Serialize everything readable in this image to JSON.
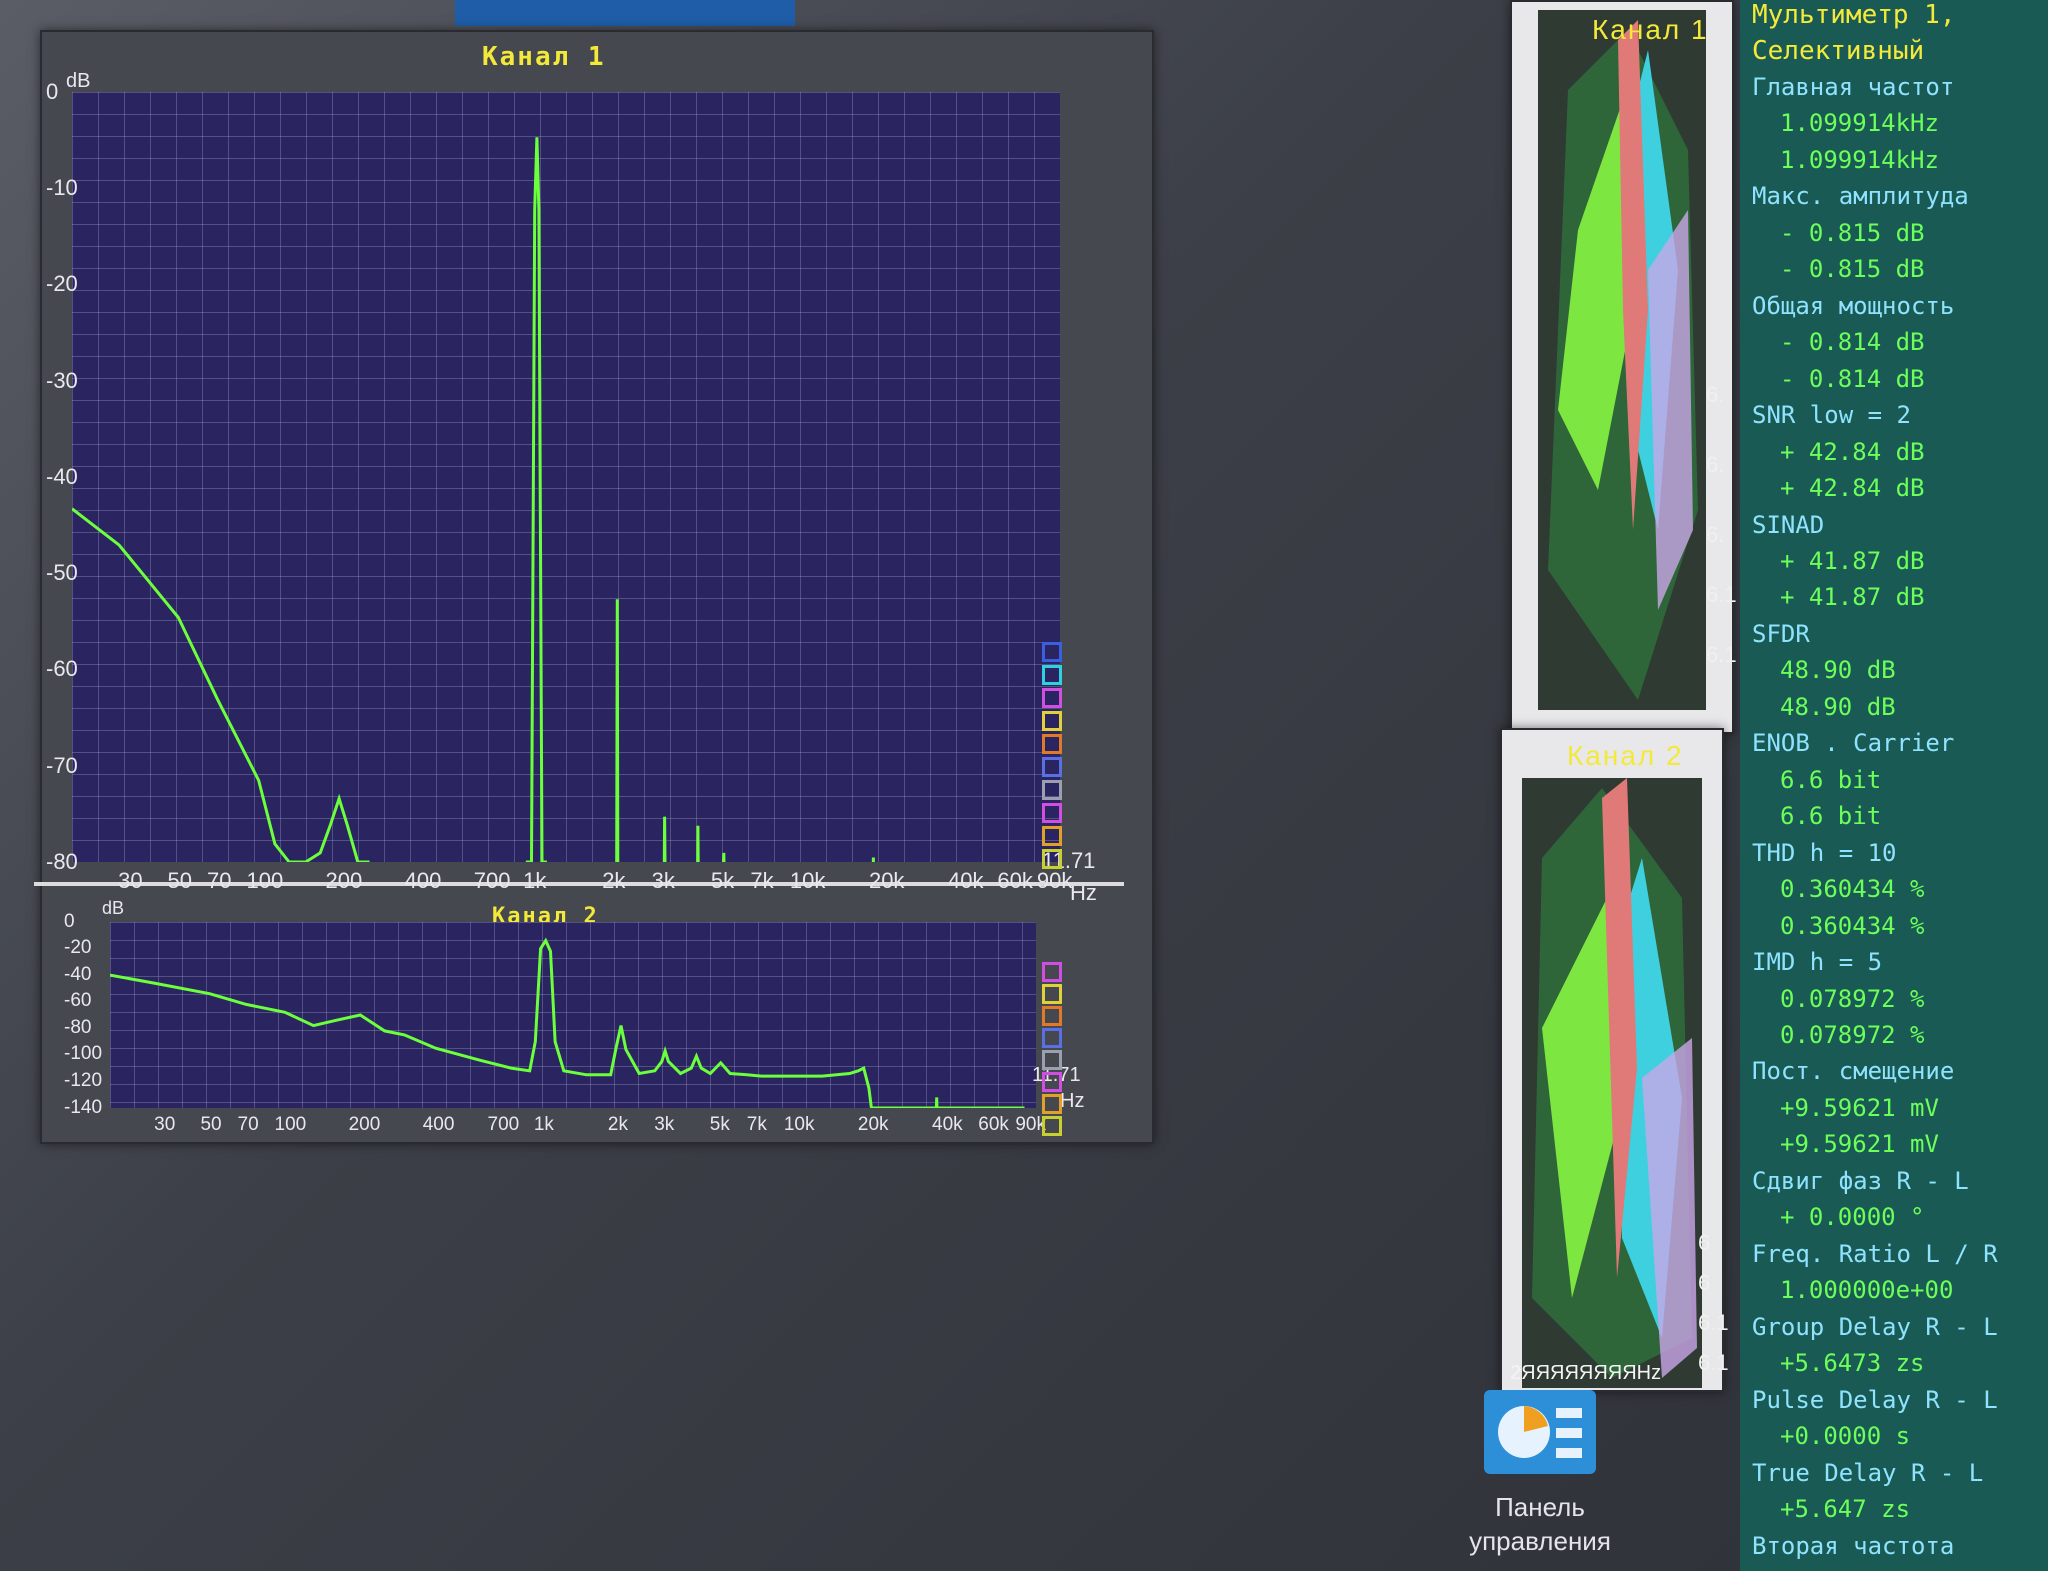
{
  "ch1": {
    "title": "Канал 1",
    "y_unit": "dB",
    "y_ticks": [
      "0",
      "-10",
      "-20",
      "-30",
      "-40",
      "-50",
      "-60",
      "-70",
      "-80"
    ],
    "x_ticks": [
      "30",
      "50",
      "70",
      "100",
      "200",
      "400",
      "700",
      "1k",
      "2k",
      "3k",
      "5k",
      "7k",
      "10k",
      "20k",
      "40k",
      "60k",
      "90k"
    ],
    "x_unit": "Hz",
    "corner_value": "11.71"
  },
  "ch2": {
    "title": "Канал 2",
    "y_unit": "dB",
    "y_ticks": [
      "0",
      "-20",
      "-40",
      "-60",
      "-80",
      "-100",
      "-120",
      "-140"
    ],
    "x_ticks": [
      "30",
      "50",
      "70",
      "100",
      "200",
      "400",
      "700",
      "1k",
      "2k",
      "3k",
      "5k",
      "7k",
      "10k",
      "20k",
      "40k",
      "60k",
      "90k"
    ],
    "x_unit": "Hz",
    "corner_value": "11.71"
  },
  "chart_data": [
    {
      "type": "line",
      "title": "Канал 1",
      "ylabel": "dB",
      "xlabel": "Hz",
      "x_scale": "log",
      "xlim": [
        20,
        100000
      ],
      "ylim": [
        -80,
        5
      ],
      "grid": true,
      "series": [
        {
          "x": [
            20,
            30,
            50,
            70,
            100,
            115,
            130,
            150,
            170,
            185,
            200,
            215,
            235,
            260
          ],
          "y": [
            -41,
            -45,
            -53,
            -62,
            -71,
            -78,
            -80,
            -80,
            -79,
            -76,
            -73,
            -76,
            -80,
            -80
          ]
        },
        {
          "x": [
            1000,
            1050,
            1080,
            1100,
            1120,
            1150,
            1200
          ],
          "y": [
            -80,
            -80,
            -8,
            0,
            -8,
            -80,
            -80
          ]
        },
        {
          "x": [
            2170,
            2190,
            2200,
            2210,
            2230
          ],
          "y": [
            -80,
            -80,
            -51,
            -80,
            -80
          ]
        },
        {
          "x": [
            3300,
            3310,
            3320
          ],
          "y": [
            -80,
            -75,
            -80
          ]
        },
        {
          "x": [
            4400,
            4410,
            4420
          ],
          "y": [
            -80,
            -76,
            -80
          ]
        },
        {
          "x": [
            5500,
            5510,
            5520
          ],
          "y": [
            -80,
            -79,
            -80
          ]
        },
        {
          "x": [
            20000,
            20010,
            20020
          ],
          "y": [
            -80,
            -79.5,
            -80
          ]
        }
      ]
    },
    {
      "type": "line",
      "title": "Канал 2",
      "ylabel": "dB",
      "xlabel": "Hz",
      "x_scale": "log",
      "xlim": [
        20,
        100000
      ],
      "ylim": [
        -140,
        0
      ],
      "grid": true,
      "series": [
        {
          "x": [
            20,
            30,
            50,
            70,
            100,
            130,
            160,
            200,
            250,
            300,
            400,
            600,
            800,
            950,
            1000,
            1050,
            1100,
            1150,
            1200,
            1300,
            1600,
            2000,
            2100,
            2200,
            2300,
            2600,
            3000,
            3200,
            3300,
            3400,
            3800,
            4200,
            4400,
            4600,
            5000,
            5500,
            6000,
            7000,
            8000,
            10000,
            14000,
            18000,
            19500,
            20500,
            21500,
            22000,
            40000,
            60000,
            90000
          ],
          "y": [
            -40,
            -46,
            -54,
            -62,
            -68,
            -78,
            -74,
            -70,
            -82,
            -85,
            -95,
            -104,
            -110,
            -112,
            -90,
            -20,
            -14,
            -22,
            -90,
            -112,
            -115,
            -115,
            -95,
            -78,
            -96,
            -114,
            -112,
            -105,
            -97,
            -105,
            -114,
            -110,
            -101,
            -110,
            -114,
            -106,
            -114,
            -115,
            -116,
            -116,
            -116,
            -114,
            -112,
            -110,
            -125,
            -140,
            -140,
            -140,
            -140
          ]
        },
        {
          "x": [
            40000,
            40100,
            40200
          ],
          "y": [
            -140,
            -132,
            -140
          ]
        }
      ]
    }
  ],
  "waterfall1": {
    "title": "Канал 1",
    "side_ticks": [
      "6.",
      "6.",
      "6.",
      "6.1",
      "6.1"
    ]
  },
  "waterfall2": {
    "title": "Канал 2",
    "bottom_label": "2ЯЯЯЯЯЯЯЯHz",
    "side_ticks": [
      "6",
      "6",
      "6.1",
      "6.1"
    ]
  },
  "control_panel": {
    "label_line1": "Панель",
    "label_line2": "управления"
  },
  "multimeter": {
    "rows": [
      {
        "text": "Мультиметр 1,",
        "kind": "title"
      },
      {
        "text": "Селективный",
        "kind": "title"
      },
      {
        "text": "Главная частот",
        "kind": "label"
      },
      {
        "text": "1.099914kHz",
        "kind": "value"
      },
      {
        "text": "1.099914kHz",
        "kind": "value"
      },
      {
        "text": "Макс. амплитуда",
        "kind": "label"
      },
      {
        "text": "-  0.815 dB",
        "kind": "value"
      },
      {
        "text": "-  0.815 dB",
        "kind": "value"
      },
      {
        "text": "Общая мощность",
        "kind": "label"
      },
      {
        "text": "-  0.814 dB",
        "kind": "value"
      },
      {
        "text": "-  0.814 dB",
        "kind": "value"
      },
      {
        "text": "SNR    low =  2",
        "kind": "label"
      },
      {
        "text": "+ 42.84 dB",
        "kind": "value"
      },
      {
        "text": "+ 42.84 dB",
        "kind": "value"
      },
      {
        "text": "SINAD",
        "kind": "label"
      },
      {
        "text": "+ 41.87 dB",
        "kind": "value"
      },
      {
        "text": "+ 41.87 dB",
        "kind": "value"
      },
      {
        "text": "SFDR",
        "kind": "label"
      },
      {
        "text": "48.90 dB",
        "kind": "value"
      },
      {
        "text": "48.90 dB",
        "kind": "value"
      },
      {
        "text": "ENOB . Carrier",
        "kind": "label"
      },
      {
        "text": "6.6 bit",
        "kind": "value"
      },
      {
        "text": "6.6 bit",
        "kind": "value"
      },
      {
        "text": "THD      h = 10",
        "kind": "label"
      },
      {
        "text": "0.360434 %",
        "kind": "value"
      },
      {
        "text": "0.360434 %",
        "kind": "value"
      },
      {
        "text": "IMD      h =  5",
        "kind": "label"
      },
      {
        "text": "0.078972 %",
        "kind": "value"
      },
      {
        "text": "0.078972 %",
        "kind": "value"
      },
      {
        "text": "Пост. смещение",
        "kind": "label"
      },
      {
        "text": "+9.59621 mV",
        "kind": "value"
      },
      {
        "text": "+9.59621 mV",
        "kind": "value"
      },
      {
        "text": "Сдвиг фаз R - L",
        "kind": "label"
      },
      {
        "text": "+  0.0000 °",
        "kind": "value"
      },
      {
        "text": "Freq. Ratio  L / R",
        "kind": "label"
      },
      {
        "text": "1.000000e+00",
        "kind": "value"
      },
      {
        "text": "Group Delay R - L",
        "kind": "label"
      },
      {
        "text": "+5.6473 zs",
        "kind": "value"
      },
      {
        "text": "Pulse Delay R - L",
        "kind": "label"
      },
      {
        "text": "+0.0000  s",
        "kind": "value"
      },
      {
        "text": "True Delay R - L",
        "kind": "label"
      },
      {
        "text": "+5.647 zs",
        "kind": "value"
      },
      {
        "text": "Вторая частота",
        "kind": "label"
      }
    ]
  },
  "colors": {
    "plot_bg": "#2a2560",
    "trace": "#6cff3c",
    "title": "#f2e93a",
    "meter_label": "#8fe3ff",
    "meter_value": "#6cff5a"
  },
  "legend1": [
    "#3a5fe0",
    "#2fd0e0",
    "#d04fe0",
    "#e0d03a",
    "#e07a2a",
    "#5a6fe0",
    "#9aa0b0",
    "#d04fe0",
    "#e0a02a",
    "#c8d030"
  ],
  "legend2": [
    "#d04fe0",
    "#e0d03a",
    "#e07a2a",
    "#5a6fe0",
    "#9aa0b0",
    "#d04fe0",
    "#e0a02a",
    "#c8d030"
  ]
}
